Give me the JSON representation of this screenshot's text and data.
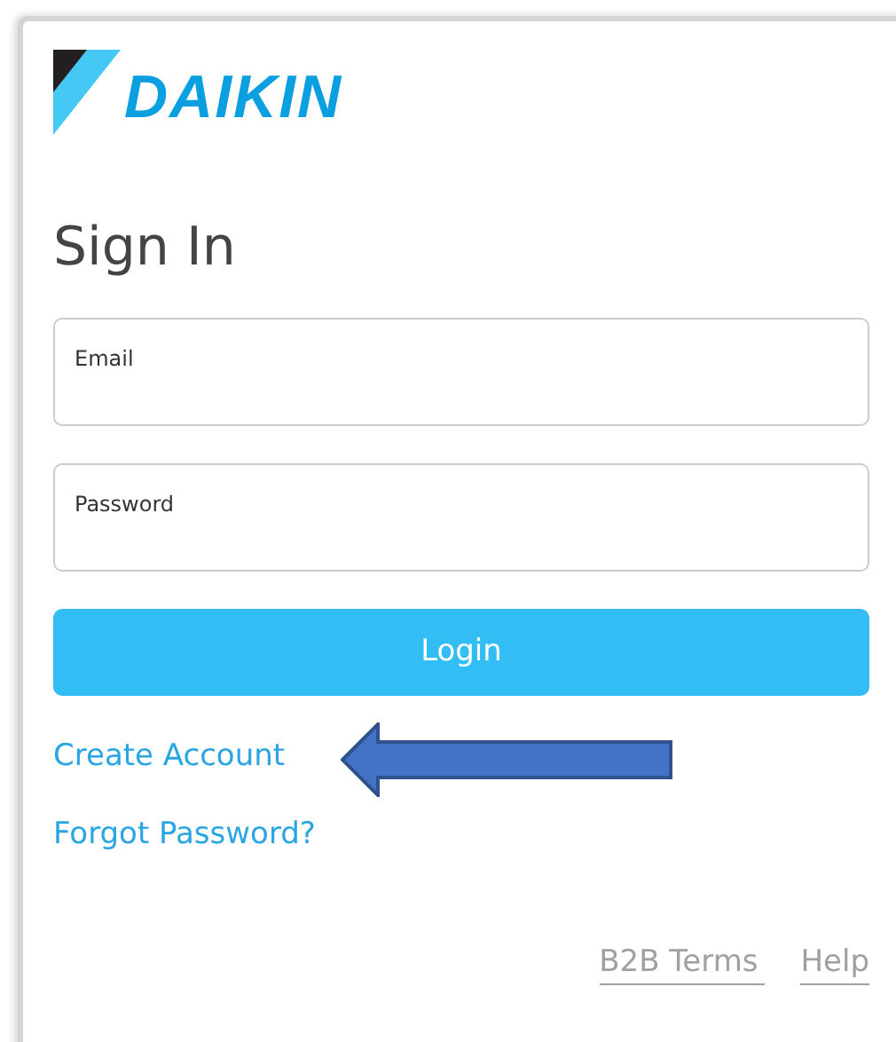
{
  "logo": {
    "text": "DAIKIN"
  },
  "title": "Sign In",
  "fields": [
    {
      "label": "Email"
    },
    {
      "label": "Password"
    }
  ],
  "login_button": "Login",
  "links": [
    "Create Account",
    "Forgot Password?"
  ],
  "annotation": {
    "kind": "arrow"
  },
  "footer_links": [
    "B2B Terms",
    "Help"
  ]
}
